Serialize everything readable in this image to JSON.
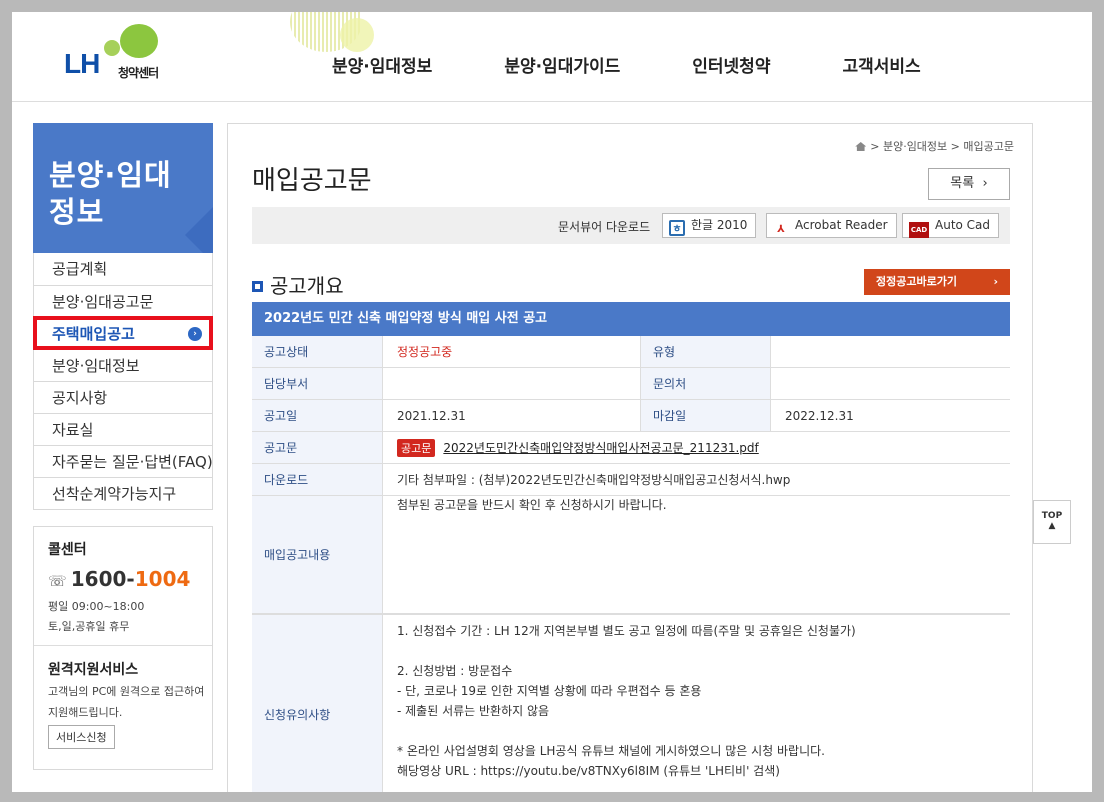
{
  "header": {
    "logo_text": "LH",
    "logo_sub": "청약센터",
    "nav": [
      "분양·임대정보",
      "분양·임대가이드",
      "인터넷청약",
      "고객서비스"
    ]
  },
  "sidebar": {
    "title_line1": "분양·임대",
    "title_line2": "정보",
    "items": [
      {
        "label": "공급계획"
      },
      {
        "label": "분양·임대공고문"
      },
      {
        "label": "주택매입공고"
      },
      {
        "label": "분양·임대정보"
      },
      {
        "label": "공지사항"
      },
      {
        "label": "자료실"
      },
      {
        "label": "자주묻는 질문·답변(FAQ)"
      },
      {
        "label": "선착순계약가능지구"
      }
    ],
    "active_index": 2
  },
  "callcenter": {
    "title": "콜센터",
    "phone_prefix": "1600-",
    "phone_suffix": "1004",
    "hours_weekday": "평일 09:00~18:00",
    "hours_weekend": "토,일,공휴일 휴무",
    "remote_title": "원격지원서비스",
    "remote_desc": "고객님의 PC에 원격으로 접근하여 지원해드립니다.",
    "remote_button": "서비스신청"
  },
  "main": {
    "breadcrumb": [
      "분양·임대정보",
      "매입공고문"
    ],
    "title": "매입공고문",
    "list_button": "목록",
    "viewer_label": "문서뷰어 다운로드",
    "viewers": [
      {
        "label": "한글 2010",
        "icon": "hwp-icon"
      },
      {
        "label": "Acrobat Reader",
        "icon": "pdf-icon"
      },
      {
        "label": "Auto Cad",
        "icon": "autocad-icon"
      }
    ],
    "section_title": "공고개요",
    "fix_button": "정정공고바로가기",
    "table": {
      "heading": "2022년도 민간 신축 매입약정 방식 매입 사전 공고",
      "status_label": "공고상태",
      "status_value": "정정공고중",
      "type_label": "유형",
      "type_value": "",
      "dept_label": "담당부서",
      "dept_value": "",
      "contact_label": "문의처",
      "contact_value": "",
      "date_label": "공고일",
      "date_value": "2021.12.31",
      "deadline_label": "마감일",
      "deadline_value": "2022.12.31",
      "doc_label": "공고문",
      "doc_tag": "공고문",
      "doc_file": "2022년도민간신축매입약정방식매입사전공고문_211231.pdf",
      "download_label": "다운로드",
      "download_value": "기타 첨부파일 : (첨부)2022년도민간신축매입약정방식매입공고신청서식.hwp",
      "content_label": "매입공고내용",
      "content_value": "첨부된 공고문을 반드시 확인 후 신청하시기 바랍니다.",
      "notes_label": "신청유의사항",
      "notes": [
        "1. 신청접수 기간 : LH 12개 지역본부별 별도 공고 일정에 따름(주말 및 공휴일은 신청불가)",
        "",
        "2. 신청방법 : 방문접수",
        "- 단, 코로나 19로 인한 지역별 상황에 따라 우편접수 등 혼용",
        "- 제출된 서류는 반환하지 않음",
        "",
        "* 온라인 사업설명회 영상을 LH공식 유튜브 채널에 게시하였으니 많은 시청 바랍니다.",
        "해당영상 URL : https://youtu.be/v8TNXy6l8IM (유튜브 'LH티비' 검색)"
      ]
    }
  },
  "top_button": "TOP",
  "colors": {
    "accent": "#4a79c8",
    "highlight": "#e8101c",
    "button": "#d1461a",
    "phone": "#ee6a12"
  }
}
